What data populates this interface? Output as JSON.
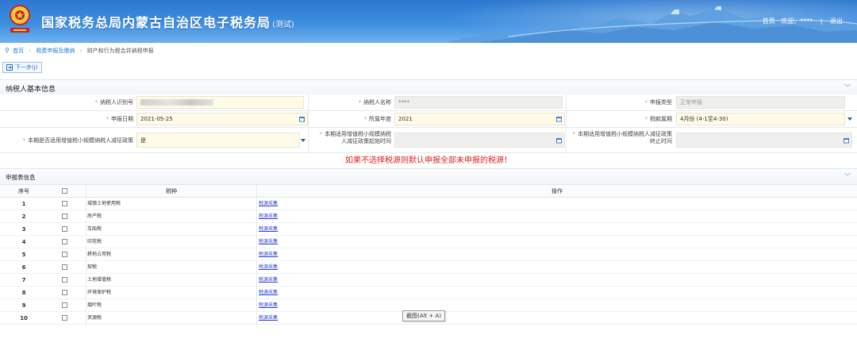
{
  "header": {
    "title": "国家税务总局内蒙古自治区电子税务局",
    "test_tag": "(测试)",
    "home_link": "首页",
    "welcome": "欢迎，****",
    "separator": "|",
    "logout": "退出"
  },
  "breadcrumb": {
    "home": "首页",
    "level2": "税费申报及缴纳",
    "current": "财产和行为税合并纳税申报"
  },
  "toolbar": {
    "next_label": "下一步(J)"
  },
  "basic_section": {
    "title": "纳税人基本信息"
  },
  "form": {
    "taxpayer_id": {
      "label": "纳税人识别号",
      "value": ""
    },
    "taxpayer_name": {
      "label": "纳税人名称",
      "value": "****"
    },
    "declare_type": {
      "label": "申报类型",
      "value": "正常申报"
    },
    "declare_date": {
      "label": "申报日期",
      "value": "2021-05-25"
    },
    "year": {
      "label": "所属年度",
      "value": "2021"
    },
    "period": {
      "label": "税款属期",
      "value": "4月份 (4-1至4-30)"
    },
    "small_policy": {
      "label": "本期是否适用增值税小规模纳税人减征政策",
      "value": "是"
    },
    "policy_start": {
      "label_line1": "本期适用增值税小规模纳税",
      "label_line2": "人减征政策起始时间",
      "value": ""
    },
    "policy_end": {
      "label_line1": "本期适用增值税小规模纳税人减征政策",
      "label_line2": "终止时间",
      "value": ""
    }
  },
  "warning": "如果不选择税源则默认申报全部未申报的税源！",
  "table_section": {
    "title": "申报表信息"
  },
  "table": {
    "headers": {
      "index": "序号",
      "tax_type": "税种",
      "operation": "操作"
    },
    "rows": [
      {
        "index": "1",
        "name": "城镇土地使用税",
        "op": "税源采集"
      },
      {
        "index": "2",
        "name": "房产税",
        "op": "税源采集"
      },
      {
        "index": "3",
        "name": "车船税",
        "op": "税源采集"
      },
      {
        "index": "4",
        "name": "印花税",
        "op": "税源采集"
      },
      {
        "index": "5",
        "name": "耕地占用税",
        "op": "税源采集"
      },
      {
        "index": "6",
        "name": "契税",
        "op": "税源采集"
      },
      {
        "index": "7",
        "name": "土地增值税",
        "op": "税源采集"
      },
      {
        "index": "8",
        "name": "环境保护税",
        "op": "税源采集"
      },
      {
        "index": "9",
        "name": "烟叶税",
        "op": "税源采集"
      },
      {
        "index": "10",
        "name": "资源税",
        "op": "税源采集"
      }
    ]
  },
  "tooltip": "截图(Alt + A)",
  "colors": {
    "header_blue": "#2c78cf",
    "link_blue": "#1e7fd6",
    "warning_red": "#e3221c",
    "required_orange": "#f08a2b",
    "field_yellow": "#fffbe6"
  },
  "icons": {
    "emblem": "tax-emblem-icon",
    "pin": "location-pin-icon",
    "next": "next-step-icon",
    "calendar": "calendar-icon",
    "collapse": "chevron-down-icon"
  }
}
